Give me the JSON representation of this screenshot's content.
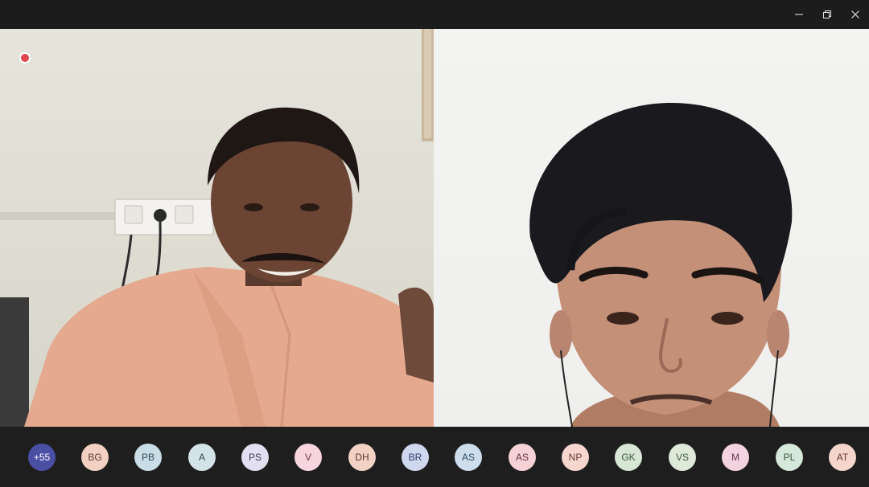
{
  "window": {
    "controls": {
      "minimize": "─",
      "restore": "❐",
      "close": "✕"
    }
  },
  "participants": [
    {
      "initials": "+55",
      "color": "#4b4fa4",
      "text_color": "#ffffff"
    },
    {
      "initials": "BG",
      "color": "#f2d1c2",
      "text_color": "#5a3a2e"
    },
    {
      "initials": "PB",
      "color": "#c9dde6",
      "text_color": "#2f4b57"
    },
    {
      "initials": "A",
      "color": "#d4e3e8",
      "text_color": "#2f4b57"
    },
    {
      "initials": "PS",
      "color": "#e2dff0",
      "text_color": "#3f3a5a"
    },
    {
      "initials": "V",
      "color": "#f6d5de",
      "text_color": "#6a3442"
    },
    {
      "initials": "DH",
      "color": "#f1d2c4",
      "text_color": "#5a3a2e"
    },
    {
      "initials": "BR",
      "color": "#cfd8ef",
      "text_color": "#2f3d66"
    },
    {
      "initials": "AS",
      "color": "#cdddeb",
      "text_color": "#2f4b66"
    },
    {
      "initials": "AS",
      "color": "#f6d1d6",
      "text_color": "#6a3440"
    },
    {
      "initials": "NP",
      "color": "#f6d6cf",
      "text_color": "#6a3a30"
    },
    {
      "initials": "GK",
      "color": "#d8e6d6",
      "text_color": "#3a5a3a"
    },
    {
      "initials": "VS",
      "color": "#dfe9da",
      "text_color": "#3f5a3a"
    },
    {
      "initials": "M",
      "color": "#f4d3e0",
      "text_color": "#6a3450"
    },
    {
      "initials": "PL",
      "color": "#d6e8d9",
      "text_color": "#3a5a42"
    },
    {
      "initials": "AT",
      "color": "#f4d6cd",
      "text_color": "#6a3a30"
    }
  ],
  "colors": {
    "recording_indicator": "#e0474f",
    "window_background": "#1f1f1f"
  }
}
